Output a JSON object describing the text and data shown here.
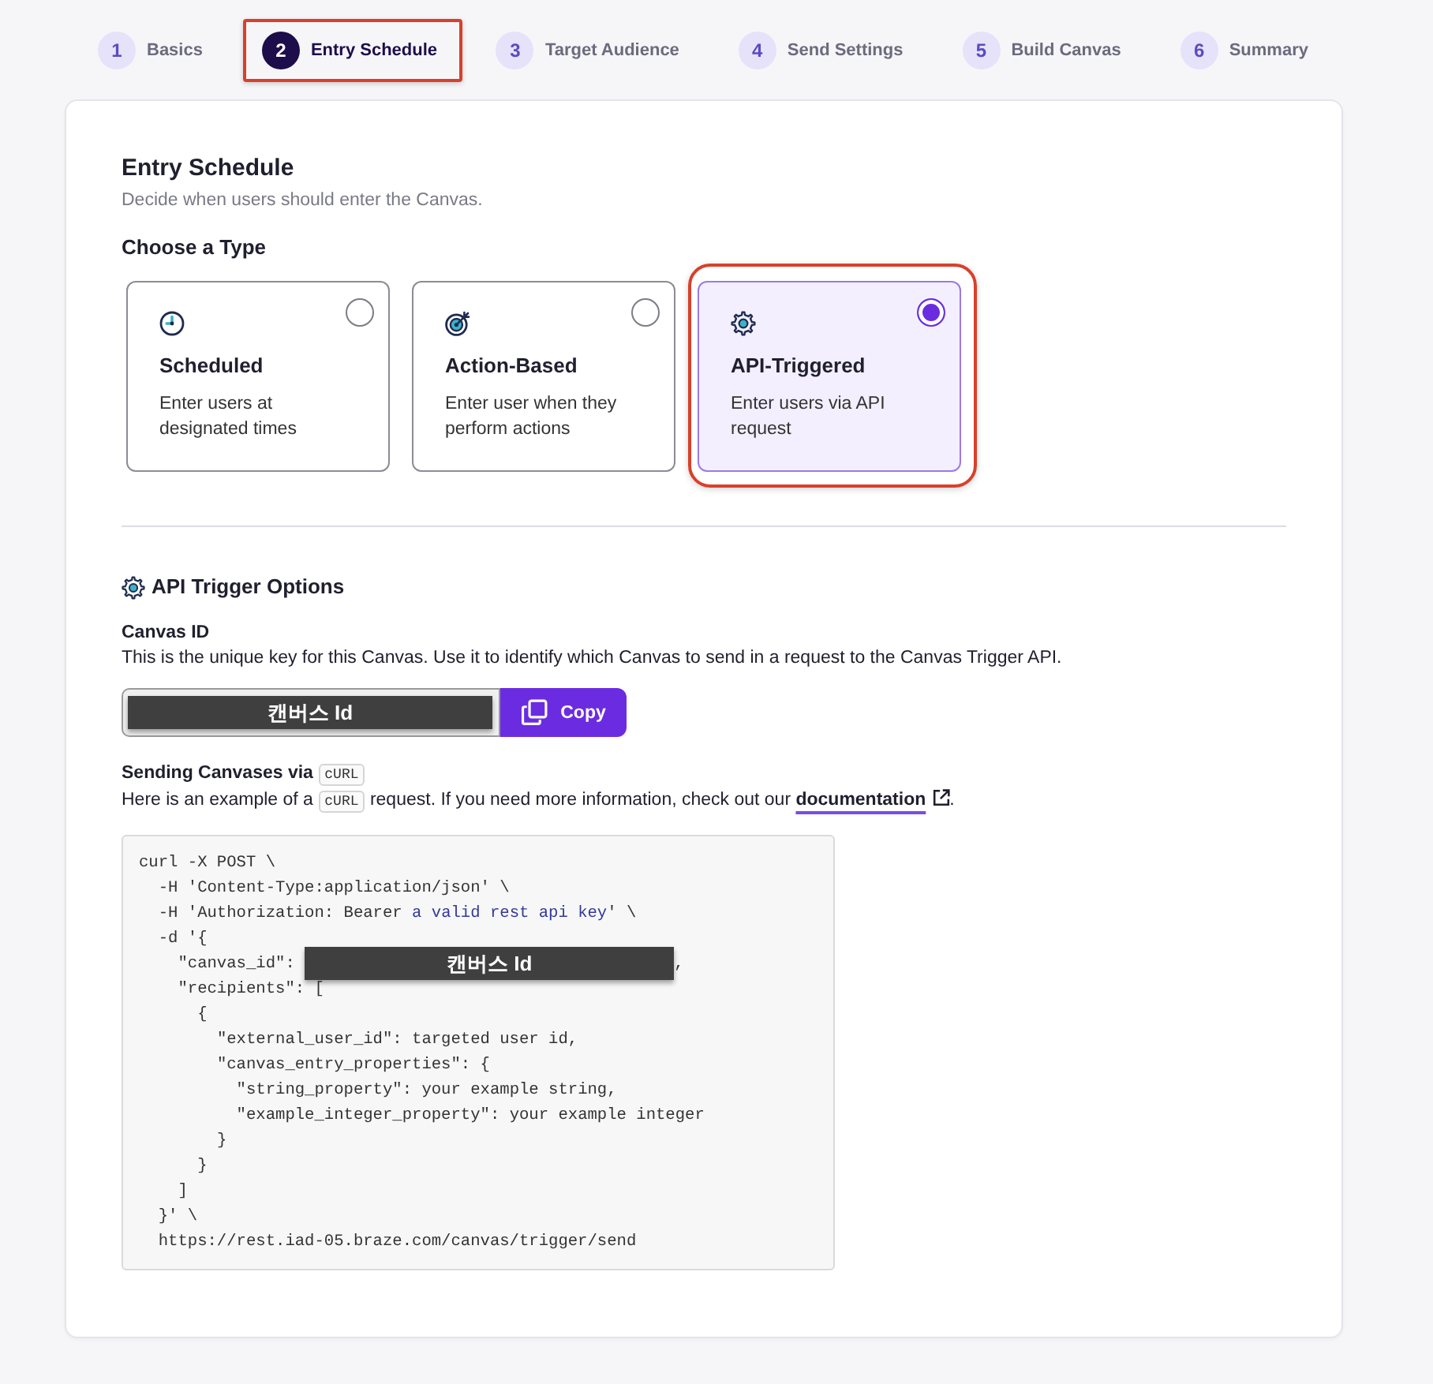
{
  "steps": [
    {
      "number": "1",
      "label": "Basics",
      "selected": false,
      "highlighted": false
    },
    {
      "number": "2",
      "label": "Entry Schedule",
      "selected": true,
      "highlighted": true
    },
    {
      "number": "3",
      "label": "Target Audience",
      "selected": false,
      "highlighted": false
    },
    {
      "number": "4",
      "label": "Send Settings",
      "selected": false,
      "highlighted": false
    },
    {
      "number": "5",
      "label": "Build Canvas",
      "selected": false,
      "highlighted": false
    },
    {
      "number": "6",
      "label": "Summary",
      "selected": false,
      "highlighted": false
    }
  ],
  "entry_schedule": {
    "title": "Entry Schedule",
    "subtitle": "Decide when users should enter the Canvas.",
    "type_label": "Choose a Type",
    "types": [
      {
        "kind": "clock",
        "title": "Scheduled",
        "description": "Enter users at designated times",
        "selected": false,
        "highlighted": false
      },
      {
        "kind": "target",
        "title": "Action-Based",
        "description": "Enter user when they perform actions",
        "selected": false,
        "highlighted": false
      },
      {
        "kind": "gear",
        "title": "API-Triggered",
        "description": "Enter users via API request",
        "selected": true,
        "highlighted": true
      }
    ]
  },
  "api_trigger_options": {
    "title": "API Trigger Options",
    "canvas_id": {
      "label": "Canvas ID",
      "description": "This is the unique key for this Canvas. Use it to identify which Canvas to send in a request to the Canvas Trigger API.",
      "value": "캔버스 Id",
      "copy_button": "Copy"
    },
    "sending": {
      "heading": [
        {
          "kind": "text",
          "text": "Sending Canvases via "
        },
        {
          "kind": "code",
          "text": "cURL"
        }
      ],
      "description": [
        {
          "kind": "text",
          "text": "Here is an example of a "
        },
        {
          "kind": "code",
          "text": "cURL"
        },
        {
          "kind": "text",
          "text": " request. If you need more information, check out our "
        },
        {
          "kind": "link",
          "text": "documentation"
        },
        {
          "kind": "text",
          "text": "."
        }
      ],
      "code_lines": [
        [
          {
            "kind": "plain",
            "text": "curl -X POST \\"
          }
        ],
        [
          {
            "kind": "plain",
            "text": "  -H 'Content-Type:application/json' \\"
          }
        ],
        [
          {
            "kind": "plain",
            "text": "  -H 'Authorization: Bearer "
          },
          {
            "kind": "value",
            "text": "a valid rest api key"
          },
          {
            "kind": "plain",
            "text": "' \\"
          }
        ],
        [
          {
            "kind": "plain",
            "text": "  -d '{"
          }
        ],
        [
          {
            "kind": "plain",
            "text": "    \"canvas_id\": "
          },
          {
            "kind": "redacted",
            "text": "캔버스 Id"
          },
          {
            "kind": "plain",
            "text": ","
          }
        ],
        [
          {
            "kind": "plain",
            "text": "    \"recipients\": ["
          }
        ],
        [
          {
            "kind": "plain",
            "text": "      {"
          }
        ],
        [
          {
            "kind": "plain",
            "text": "        \"external_user_id\": targeted user id,"
          }
        ],
        [
          {
            "kind": "plain",
            "text": "        \"canvas_entry_properties\": {"
          }
        ],
        [
          {
            "kind": "plain",
            "text": "          \"string_property\": your example string,"
          }
        ],
        [
          {
            "kind": "plain",
            "text": "          \"example_integer_property\": your example integer"
          }
        ],
        [
          {
            "kind": "plain",
            "text": "        }"
          }
        ],
        [
          {
            "kind": "plain",
            "text": "      }"
          }
        ],
        [
          {
            "kind": "plain",
            "text": "    ]"
          }
        ],
        [
          {
            "kind": "plain",
            "text": "  }' \\"
          }
        ],
        [
          {
            "kind": "plain",
            "text": "  https://rest.iad-05.braze.com/canvas/trigger/send"
          }
        ]
      ]
    }
  }
}
